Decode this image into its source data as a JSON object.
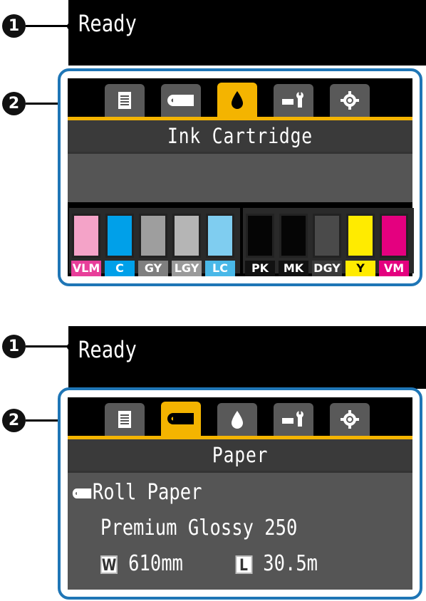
{
  "callouts": {
    "one": "1",
    "two": "2"
  },
  "panel1": {
    "status": "Ready",
    "title": "Ink Cartridge",
    "active_tab": "ink",
    "inks": [
      {
        "label": "VLM",
        "color": "#f4a3c8",
        "label_bg": "#e83e9a"
      },
      {
        "label": "C",
        "color": "#00a0e9",
        "label_bg": "#00a0e9"
      },
      {
        "label": "GY",
        "color": "#9e9e9e",
        "label_bg": "#7f7f7f"
      },
      {
        "label": "LGY",
        "color": "#b5b5b5",
        "label_bg": "#9a9a9a"
      },
      {
        "label": "LC",
        "color": "#7fcdf0",
        "label_bg": "#49b8e8"
      },
      {
        "label": "PK",
        "color": "#050505",
        "label_bg": "#111111"
      },
      {
        "label": "MK",
        "color": "#050505",
        "label_bg": "#111111"
      },
      {
        "label": "DGY",
        "color": "#4a4a4a",
        "label_bg": "#3a3a3a"
      },
      {
        "label": "Y",
        "color": "#ffeb00",
        "label_bg": "#ffeb00"
      },
      {
        "label": "VM",
        "color": "#e4007f",
        "label_bg": "#e4007f"
      }
    ]
  },
  "panel2": {
    "status": "Ready",
    "title": "Paper",
    "active_tab": "paper",
    "source": "Roll Paper",
    "media": "Premium Glossy 250",
    "width_badge": "W",
    "width_value": "610mm",
    "length_badge": "L",
    "length_value": "30.5m"
  },
  "tabs": [
    {
      "id": "print-queue",
      "icon": "document-icon"
    },
    {
      "id": "paper",
      "icon": "paper-roll-icon"
    },
    {
      "id": "ink",
      "icon": "ink-drop-icon"
    },
    {
      "id": "maintenance",
      "icon": "wrench-icon"
    },
    {
      "id": "setup",
      "icon": "gear-icon"
    }
  ],
  "colors": {
    "accent": "#f4b400",
    "frame": "#1f76b6"
  }
}
